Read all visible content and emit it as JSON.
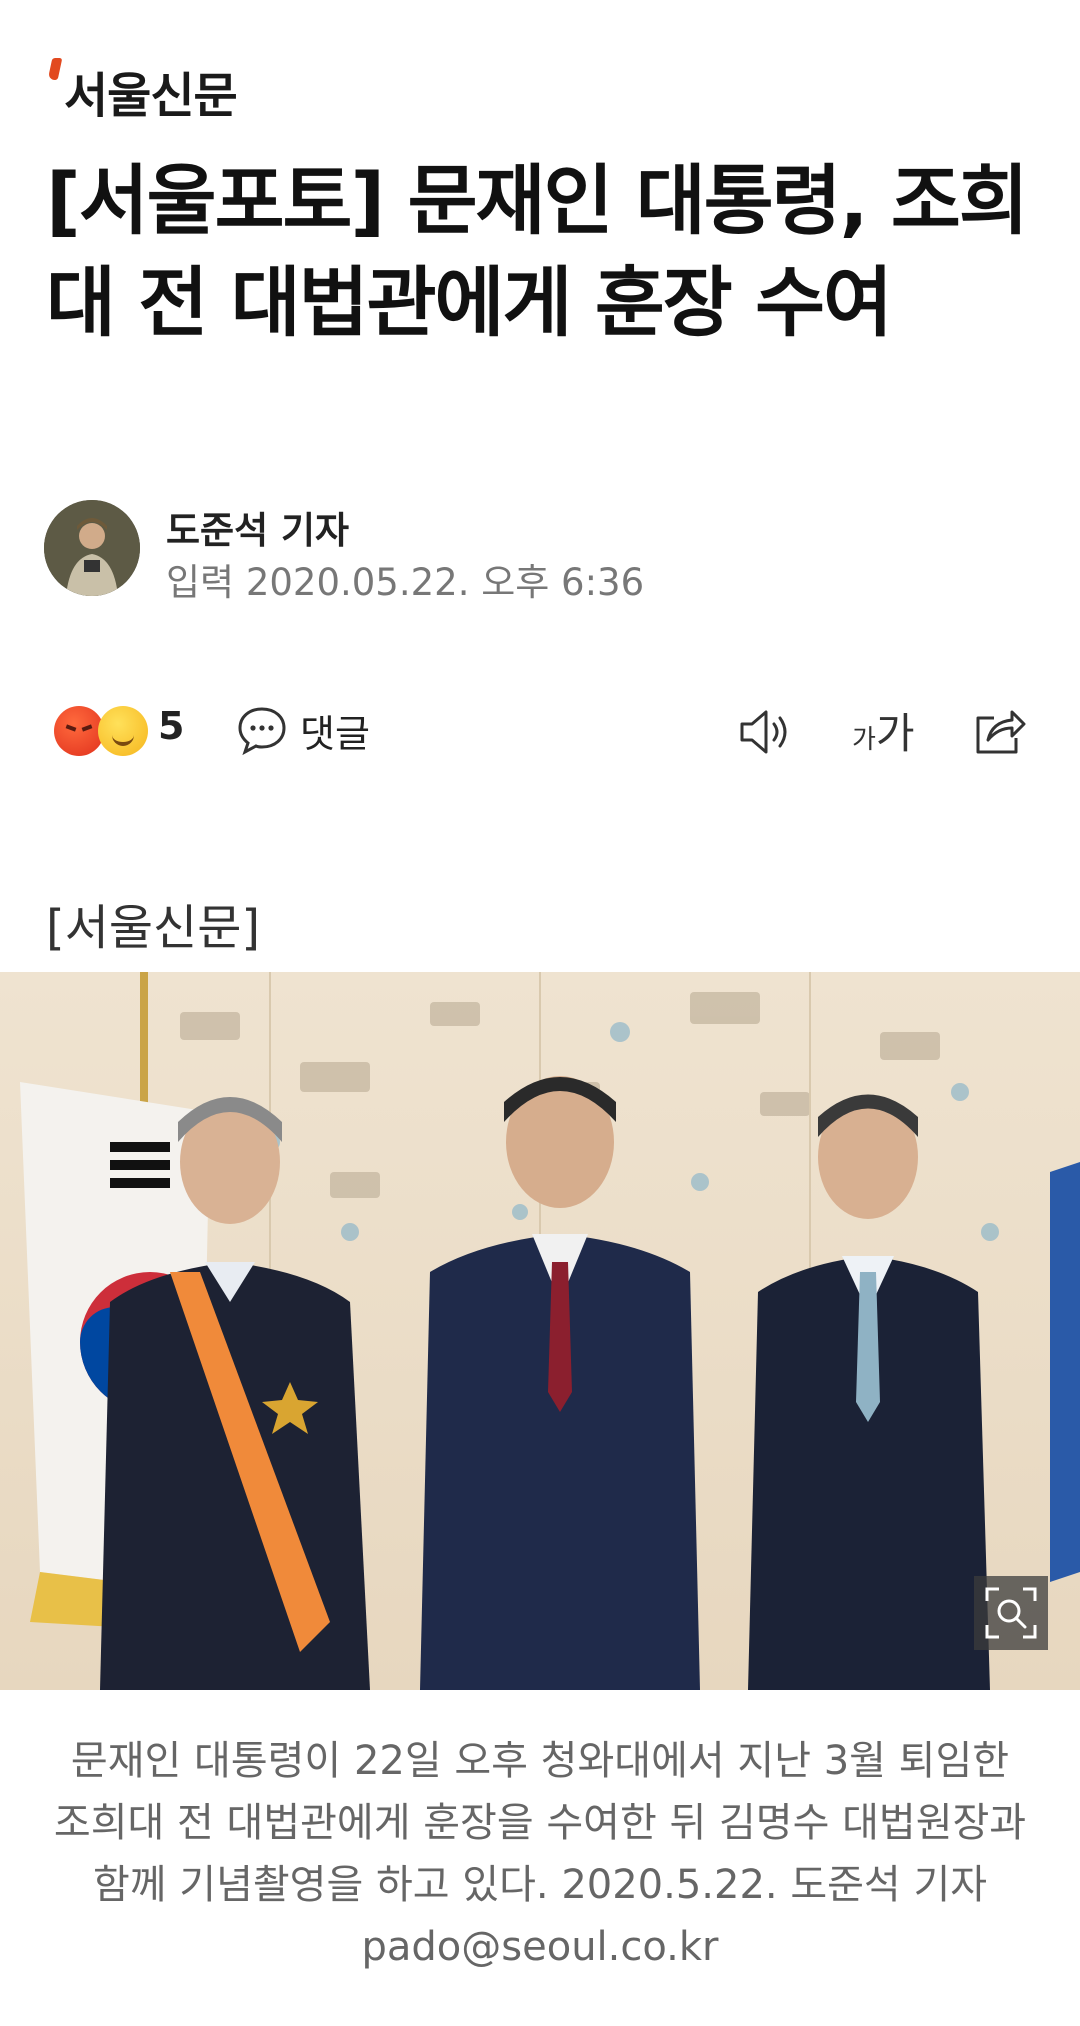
{
  "header": {
    "logo_text": "서울신문"
  },
  "article": {
    "headline": "[서울포토] 문재인 대통령, 조희대 전 대법관에게 훈장 수여",
    "author": "도준석 기자",
    "timestamp": "입력 2020.05.22. 오후 6:36",
    "source_tag": "[서울신문]",
    "caption": "문재인 대통령이 22일 오후 청와대에서 지난 3월 퇴임한 조희대 전 대법관에게 훈장을 수여한 뒤 김명수 대법원장과 함께 기념촬영을 하고 있다. 2020.5.22. 도준석 기자 pado@seoul.co.kr"
  },
  "toolbar": {
    "reaction_icons": [
      "angry-emoji-icon",
      "smile-emoji-icon"
    ],
    "reaction_count": "5",
    "comment_label": "댓글",
    "comment_icon": "speech-bubble-icon",
    "speaker_icon": "speaker-icon",
    "font_size_small": "가",
    "font_size_large": "가",
    "share_icon": "share-icon"
  },
  "photo": {
    "zoom_icon": "zoom-icon"
  },
  "colors": {
    "logo_accent": "#e2491f",
    "caption_text": "#666666",
    "date_text": "#777777"
  }
}
